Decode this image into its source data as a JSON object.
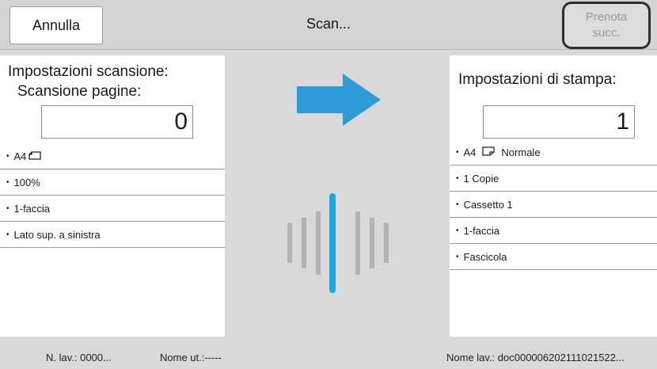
{
  "header": {
    "cancel_label": "Annulla",
    "title": "Scan...",
    "reserve_line1": "Prenota",
    "reserve_line2": "succ."
  },
  "scan_panel": {
    "title_line1": "Impostazioni scansione:",
    "title_line2": "Scansione pagine:",
    "count": "0",
    "items": [
      {
        "label": "A4",
        "icon": "paper-landscape-icon"
      },
      {
        "label": "100%"
      },
      {
        "label": "1-faccia"
      },
      {
        "label": "Lato sup. a sinistra"
      }
    ]
  },
  "print_panel": {
    "title": "Impostazioni di stampa:",
    "count": "1",
    "items": [
      {
        "label": "A4",
        "icon": "paper-portrait-icon",
        "extra": "Normale"
      },
      {
        "label": "1 Copie"
      },
      {
        "label": "Cassetto 1"
      },
      {
        "label": "1-faccia"
      },
      {
        "label": "Fascicola"
      }
    ]
  },
  "status": {
    "job_no": "N. lav.: 0000...",
    "user_name": "Nome ut.:-----",
    "job_name": "Nome lav.: doc000006202111021522..."
  },
  "colors": {
    "arrow": "#2f9bd6",
    "scan_line": "#1fa5e0",
    "wave_bars": "#b3b3b3"
  }
}
